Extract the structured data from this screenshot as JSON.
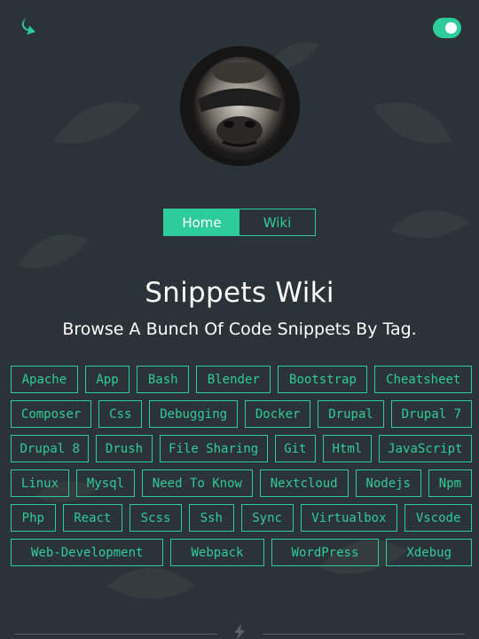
{
  "header": {
    "logo_icon": "curved-arrow-icon",
    "theme_toggle_icon": "toggle-switch-icon"
  },
  "profile": {
    "avatar": "gorilla-avatar"
  },
  "nav": {
    "home_label": "Home",
    "wiki_label": "Wiki"
  },
  "page": {
    "title": "Snippets Wiki",
    "subtitle": "Browse A Bunch Of Code Snippets By Tag."
  },
  "tags": [
    "Apache",
    "App",
    "Bash",
    "Blender",
    "Bootstrap",
    "Cheatsheet",
    "Composer",
    "Css",
    "Debugging",
    "Docker",
    "Drupal",
    "Drupal 7",
    "Drupal 8",
    "Drush",
    "File Sharing",
    "Git",
    "Html",
    "JavaScript",
    "Linux",
    "Mysql",
    "Need To Know",
    "Nextcloud",
    "Nodejs",
    "Npm",
    "Php",
    "React",
    "Scss",
    "Ssh",
    "Sync",
    "Virtualbox",
    "Vscode",
    "Web-Development",
    "Webpack",
    "WordPress",
    "Xdebug"
  ],
  "footer": {
    "divider_icon": "lightning-bolt-icon"
  },
  "colors": {
    "background": "#2c3338",
    "accent": "#2ecc9a",
    "text": "#ffffff"
  }
}
